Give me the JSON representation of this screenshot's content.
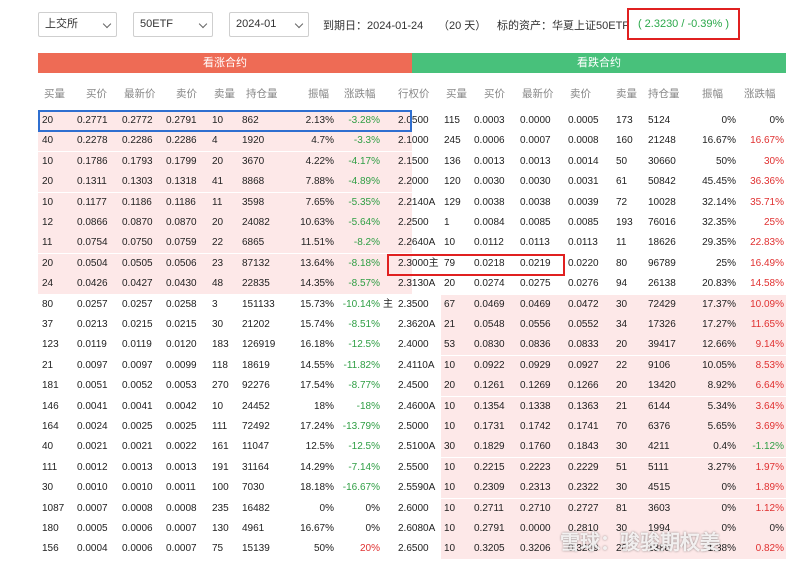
{
  "toolbar": {
    "exchange": "上交所",
    "underlying_code": "50ETF",
    "month": "2024-01",
    "expiry_label": "到期日：2024-01-24",
    "days_label": "（20 天）",
    "underlying_label": "标的资产：华夏上证50ETF",
    "price_change": "( 2.3230 / -0.39% )"
  },
  "bands": {
    "call": "看涨合约",
    "put": "看跌合约"
  },
  "call_headers": [
    "买量",
    "买价",
    "最新价",
    "卖价",
    "卖量",
    "持仓量",
    "振幅",
    "涨跌幅"
  ],
  "strike_header": "行权价",
  "put_headers": [
    "买量",
    "买价",
    "最新价",
    "卖价",
    "卖量",
    "持仓量",
    "振幅",
    "涨跌幅"
  ],
  "rows": [
    {
      "c": [
        "20",
        "0.2771",
        "0.2772",
        "0.2791",
        "10",
        "862",
        "2.13%",
        "-3.28%"
      ],
      "k": "2.0500",
      "p": [
        "115",
        "0.0003",
        "0.0000",
        "0.0005",
        "173",
        "5124",
        "0%",
        "0%"
      ]
    },
    {
      "c": [
        "40",
        "0.2278",
        "0.2286",
        "0.2286",
        "4",
        "1920",
        "4.7%",
        "-3.3%"
      ],
      "k": "2.1000",
      "p": [
        "245",
        "0.0006",
        "0.0007",
        "0.0008",
        "160",
        "21248",
        "16.67%",
        "16.67%"
      ]
    },
    {
      "c": [
        "10",
        "0.1786",
        "0.1793",
        "0.1799",
        "20",
        "3670",
        "4.22%",
        "-4.17%"
      ],
      "k": "2.1500",
      "p": [
        "136",
        "0.0013",
        "0.0013",
        "0.0014",
        "50",
        "30660",
        "50%",
        "30%"
      ]
    },
    {
      "c": [
        "20",
        "0.1311",
        "0.1303",
        "0.1318",
        "41",
        "8868",
        "7.88%",
        "-4.89%"
      ],
      "k": "2.2000",
      "p": [
        "120",
        "0.0030",
        "0.0030",
        "0.0031",
        "61",
        "50842",
        "45.45%",
        "36.36%"
      ]
    },
    {
      "c": [
        "10",
        "0.1177",
        "0.1186",
        "0.1186",
        "11",
        "3598",
        "7.65%",
        "-5.35%"
      ],
      "k": "2.2140A",
      "p": [
        "129",
        "0.0038",
        "0.0038",
        "0.0039",
        "72",
        "10028",
        "32.14%",
        "35.71%"
      ]
    },
    {
      "c": [
        "12",
        "0.0866",
        "0.0870",
        "0.0870",
        "20",
        "24082",
        "10.63%",
        "-5.64%"
      ],
      "k": "2.2500",
      "p": [
        "1",
        "0.0084",
        "0.0085",
        "0.0085",
        "193",
        "76016",
        "32.35%",
        "25%"
      ]
    },
    {
      "c": [
        "11",
        "0.0754",
        "0.0750",
        "0.0759",
        "22",
        "6865",
        "11.51%",
        "-8.2%"
      ],
      "k": "2.2640A",
      "p": [
        "10",
        "0.0112",
        "0.0113",
        "0.0113",
        "11",
        "18626",
        "29.35%",
        "22.83%"
      ]
    },
    {
      "c": [
        "20",
        "0.0504",
        "0.0505",
        "0.0506",
        "23",
        "87132",
        "13.64%",
        "-8.18%"
      ],
      "k": "2.3000主",
      "p": [
        "79",
        "0.0218",
        "0.0219",
        "0.0220",
        "80",
        "96789",
        "25%",
        "16.49%"
      ]
    },
    {
      "c": [
        "24",
        "0.0426",
        "0.0427",
        "0.0430",
        "48",
        "22835",
        "14.35%",
        "-8.57%"
      ],
      "k": "2.3130A",
      "p": [
        "20",
        "0.0274",
        "0.0275",
        "0.0276",
        "94",
        "26138",
        "20.83%",
        "14.58%"
      ]
    },
    {
      "c": [
        "80",
        "0.0257",
        "0.0257",
        "0.0258",
        "3",
        "151133",
        "15.73%",
        "-10.14%"
      ],
      "cm": "主",
      "k": "2.3500",
      "p": [
        "67",
        "0.0469",
        "0.0469",
        "0.0472",
        "30",
        "72429",
        "17.37%",
        "10.09%"
      ]
    },
    {
      "c": [
        "37",
        "0.0213",
        "0.0215",
        "0.0215",
        "30",
        "21202",
        "15.74%",
        "-8.51%"
      ],
      "k": "2.3620A",
      "p": [
        "21",
        "0.0548",
        "0.0556",
        "0.0552",
        "34",
        "17326",
        "17.27%",
        "11.65%"
      ]
    },
    {
      "c": [
        "123",
        "0.0119",
        "0.0119",
        "0.0120",
        "183",
        "126919",
        "16.18%",
        "-12.5%"
      ],
      "k": "2.4000",
      "p": [
        "53",
        "0.0830",
        "0.0836",
        "0.0833",
        "20",
        "39417",
        "12.66%",
        "9.14%"
      ]
    },
    {
      "c": [
        "21",
        "0.0097",
        "0.0097",
        "0.0099",
        "118",
        "18619",
        "14.55%",
        "-11.82%"
      ],
      "k": "2.4110A",
      "p": [
        "10",
        "0.0922",
        "0.0929",
        "0.0927",
        "22",
        "9106",
        "10.05%",
        "8.53%"
      ]
    },
    {
      "c": [
        "181",
        "0.0051",
        "0.0052",
        "0.0053",
        "270",
        "92276",
        "17.54%",
        "-8.77%"
      ],
      "k": "2.4500",
      "p": [
        "20",
        "0.1261",
        "0.1269",
        "0.1266",
        "20",
        "13420",
        "8.92%",
        "6.64%"
      ]
    },
    {
      "c": [
        "146",
        "0.0041",
        "0.0041",
        "0.0042",
        "10",
        "24452",
        "18%",
        "-18%"
      ],
      "k": "2.4600A",
      "p": [
        "10",
        "0.1354",
        "0.1338",
        "0.1363",
        "21",
        "6144",
        "5.34%",
        "3.64%"
      ]
    },
    {
      "c": [
        "164",
        "0.0024",
        "0.0025",
        "0.0025",
        "111",
        "72492",
        "17.24%",
        "-13.79%"
      ],
      "k": "2.5000",
      "p": [
        "10",
        "0.1731",
        "0.1742",
        "0.1741",
        "70",
        "6376",
        "5.65%",
        "3.69%"
      ]
    },
    {
      "c": [
        "40",
        "0.0021",
        "0.0021",
        "0.0022",
        "161",
        "11047",
        "12.5%",
        "-12.5%"
      ],
      "k": "2.5100A",
      "p": [
        "30",
        "0.1829",
        "0.1760",
        "0.1843",
        "30",
        "4211",
        "0.4%",
        "-1.12%"
      ]
    },
    {
      "c": [
        "111",
        "0.0012",
        "0.0013",
        "0.0013",
        "191",
        "31164",
        "14.29%",
        "-7.14%"
      ],
      "k": "2.5500",
      "p": [
        "10",
        "0.2215",
        "0.2223",
        "0.2229",
        "51",
        "5111",
        "3.27%",
        "1.97%"
      ]
    },
    {
      "c": [
        "30",
        "0.0010",
        "0.0010",
        "0.0011",
        "100",
        "7030",
        "18.18%",
        "-16.67%"
      ],
      "k": "2.5590A",
      "p": [
        "10",
        "0.2309",
        "0.2313",
        "0.2322",
        "30",
        "4515",
        "0%",
        "1.89%"
      ]
    },
    {
      "c": [
        "1087",
        "0.0007",
        "0.0008",
        "0.0008",
        "235",
        "16482",
        "0%",
        "0%"
      ],
      "k": "2.6000",
      "p": [
        "10",
        "0.2711",
        "0.2710",
        "0.2727",
        "81",
        "3603",
        "0%",
        "1.12%"
      ]
    },
    {
      "c": [
        "180",
        "0.0005",
        "0.0006",
        "0.0007",
        "130",
        "4961",
        "16.67%",
        "0%"
      ],
      "k": "2.6080A",
      "p": [
        "10",
        "0.2791",
        "0.0000",
        "0.2810",
        "30",
        "1994",
        "0%",
        "0%"
      ]
    },
    {
      "c": [
        "156",
        "0.0004",
        "0.0006",
        "0.0007",
        "75",
        "15139",
        "50%",
        "20%"
      ],
      "k": "2.6500",
      "p": [
        "10",
        "0.3205",
        "0.3206",
        "0.3209",
        "20",
        "1388",
        "1.38%",
        "0.82%"
      ]
    }
  ],
  "watermark": "雪球：骏骏期权姜",
  "colors": {
    "call_band": "#ee6b55",
    "put_band": "#48c17b",
    "in_the_money_row": "#fde8e8",
    "negative": "#2f9e44",
    "positive": "#e03131",
    "selected_call_row_border": "#2f6fd0",
    "highlight_border": "#e02020"
  }
}
